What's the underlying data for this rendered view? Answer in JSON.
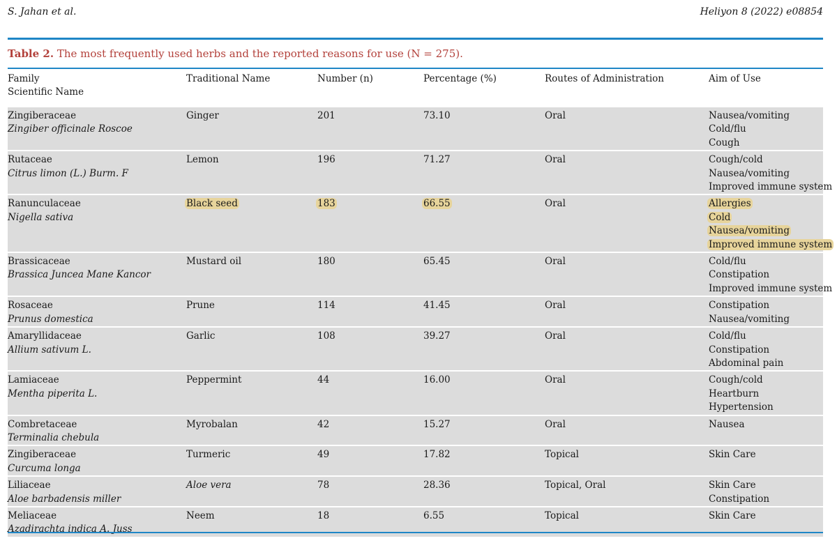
{
  "header": {
    "authors": "S. Jahan et al.",
    "journal": "Heliyon 8 (2022) e08854"
  },
  "caption": {
    "label": "Table 2.",
    "text": "The most frequently used herbs and the reported reasons for use (N = 275)."
  },
  "columns": {
    "family": "Family",
    "scientific": "Scientific Name",
    "traditional": "Traditional Name",
    "number": "Number (n)",
    "percentage": "Percentage (%)",
    "routes": "Routes of Administration",
    "aim": "Aim of Use"
  },
  "rows": [
    {
      "family": "Zingiberaceae",
      "scientific": "Zingiber officinale Roscoe",
      "traditional": "Ginger",
      "number": "201",
      "percentage": "73.10",
      "route": "Oral",
      "aims": [
        "Nausea/vomiting",
        "Cold/flu",
        "Cough"
      ]
    },
    {
      "family": "Rutaceae",
      "scientific": "Citrus limon (L.) Burm. F",
      "traditional": "Lemon",
      "number": "196",
      "percentage": "71.27",
      "route": "Oral",
      "aims": [
        "Cough/cold",
        "Nausea/vomiting",
        "Improved immune system"
      ]
    },
    {
      "family": "Ranunculaceae",
      "scientific": "Nigella sativa",
      "traditional": "Black seed",
      "number": "183",
      "percentage": "66.55",
      "route": "Oral",
      "aims": [
        "Allergies",
        "Cold",
        "Nausea/vomiting",
        "Improved immune system"
      ],
      "highlighted": true
    },
    {
      "family": "Brassicaceae",
      "scientific": "Brassica Juncea Mane Kancor",
      "traditional": "Mustard oil",
      "number": "180",
      "percentage": "65.45",
      "route": "Oral",
      "aims": [
        "Cold/flu",
        "Constipation",
        "Improved immune system"
      ]
    },
    {
      "family": "Rosaceae",
      "scientific": "Prunus domestica",
      "traditional": "Prune",
      "number": "114",
      "percentage": "41.45",
      "route": "Oral",
      "aims": [
        "Constipation",
        "Nausea/vomiting"
      ]
    },
    {
      "family": "Amaryllidaceae",
      "scientific": "Allium sativum L.",
      "traditional": "Garlic",
      "number": "108",
      "percentage": "39.27",
      "route": "Oral",
      "aims": [
        "Cold/flu",
        "Constipation",
        "Abdominal pain"
      ]
    },
    {
      "family": "Lamiaceae",
      "scientific": "Mentha piperita L.",
      "traditional": "Peppermint",
      "number": "44",
      "percentage": "16.00",
      "route": "Oral",
      "aims": [
        "Cough/cold",
        "Heartburn",
        "Hypertension"
      ]
    },
    {
      "family": "Combretaceae",
      "scientific": "Terminalia chebula",
      "traditional": "Myrobalan",
      "number": "42",
      "percentage": "15.27",
      "route": "Oral",
      "aims": [
        "Nausea"
      ]
    },
    {
      "family": "Zingiberaceae",
      "scientific": "Curcuma longa",
      "traditional": "Turmeric",
      "number": "49",
      "percentage": "17.82",
      "route": "Topical",
      "aims": [
        "Skin Care"
      ]
    },
    {
      "family": "Liliaceae",
      "scientific": "Aloe barbadensis miller",
      "traditional": "Aloe vera",
      "traditional_italic": true,
      "number": "78",
      "percentage": "28.36",
      "route": "Topical, Oral",
      "aims": [
        "Skin Care",
        "Constipation"
      ]
    },
    {
      "family": "Meliaceae",
      "scientific": "Azadirachta indica A. Juss",
      "traditional": "Neem",
      "number": "18",
      "percentage": "6.55",
      "route": "Topical",
      "aims": [
        "Skin Care"
      ]
    }
  ],
  "colors": {
    "rule": "#1f86c6",
    "caption": "#b3413b",
    "row_shade": "#dcdcdc",
    "highlight": "#e7d49b"
  }
}
